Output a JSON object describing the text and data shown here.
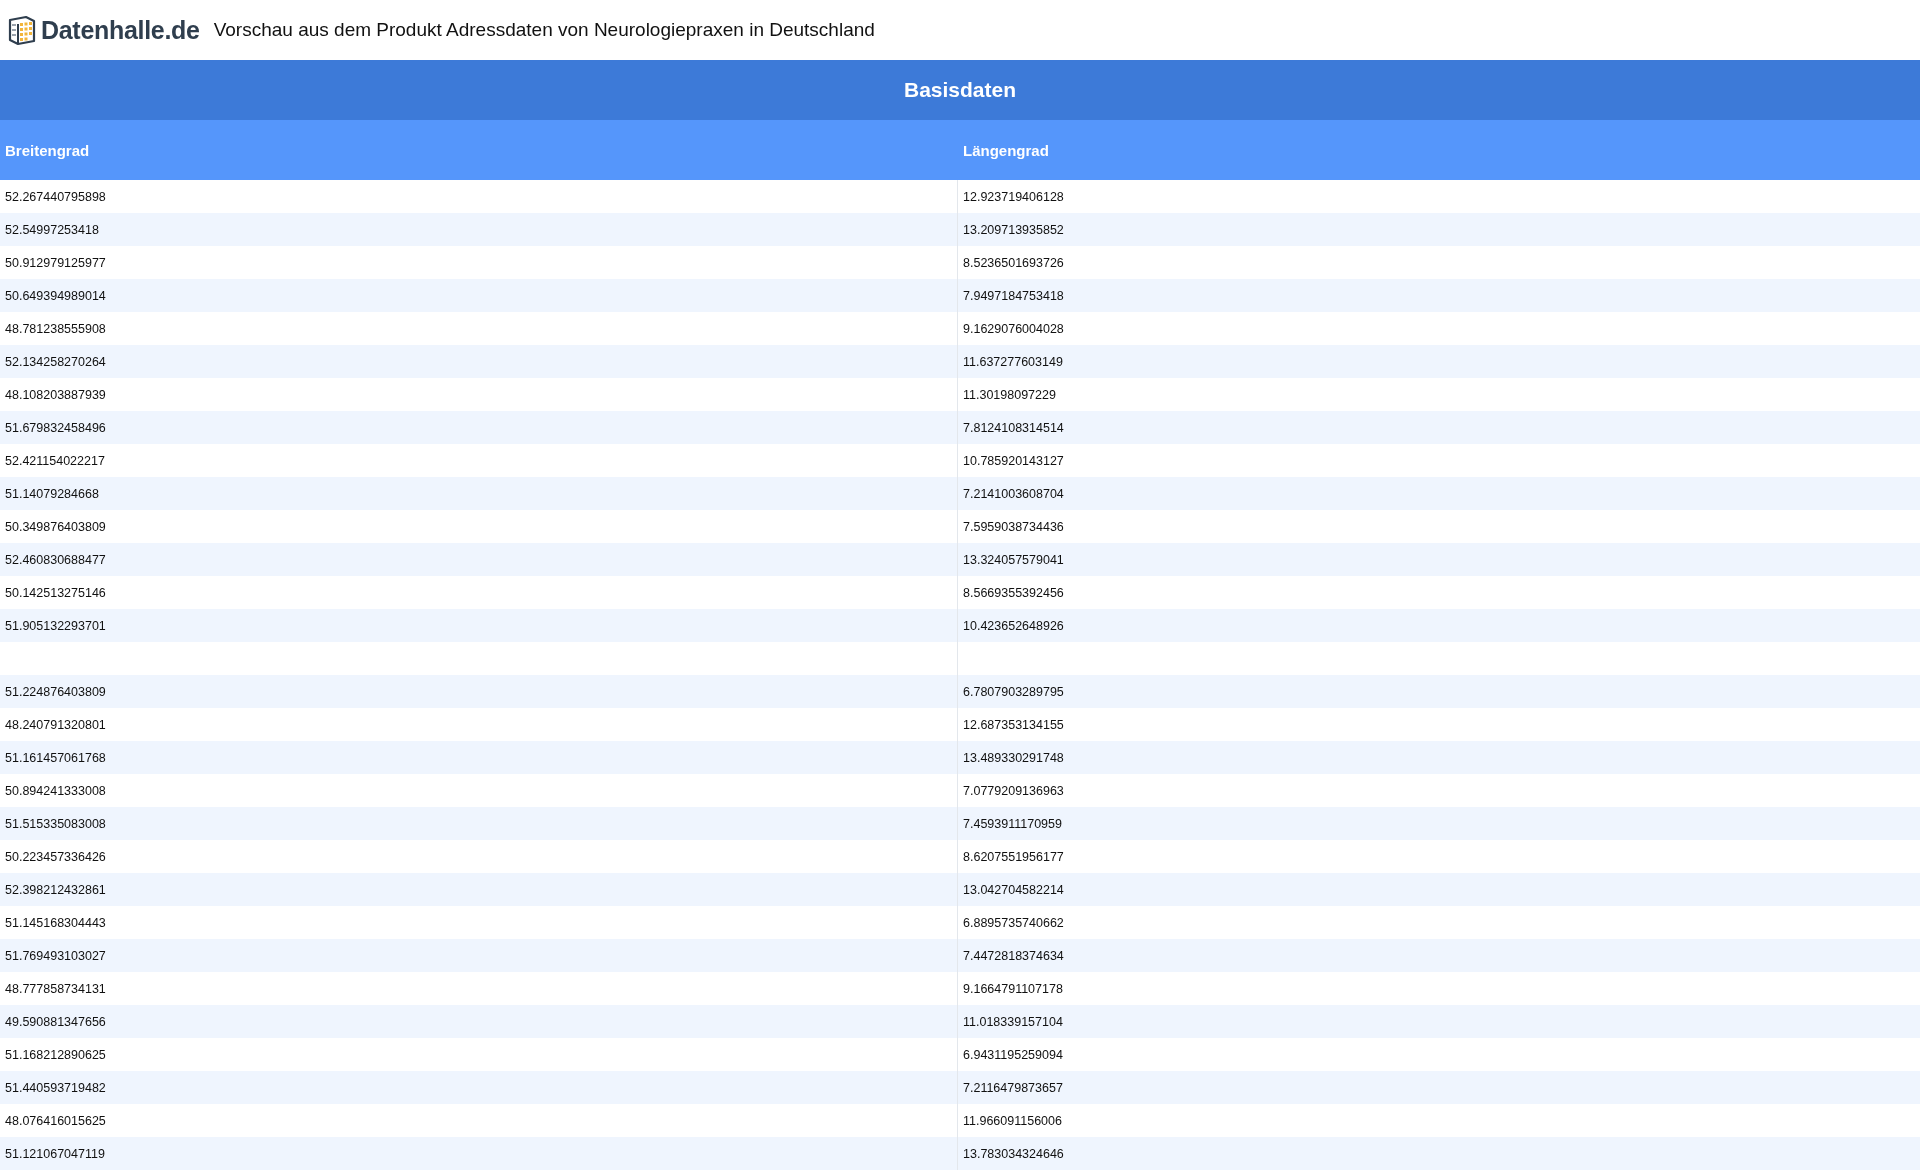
{
  "header": {
    "logo_text": "Datenhalle.de",
    "title": "Vorschau aus dem Produkt Adressdaten von Neurologiepraxen in Deutschland"
  },
  "table": {
    "caption": "Basisdaten",
    "columns": [
      "Breitengrad",
      "Längengrad"
    ],
    "rows": [
      [
        "52.267440795898",
        "12.923719406128"
      ],
      [
        "52.54997253418",
        "13.209713935852"
      ],
      [
        "50.912979125977",
        "8.5236501693726"
      ],
      [
        "50.649394989014",
        "7.9497184753418"
      ],
      [
        "48.781238555908",
        "9.1629076004028"
      ],
      [
        "52.134258270264",
        "11.637277603149"
      ],
      [
        "48.108203887939",
        "11.30198097229"
      ],
      [
        "51.679832458496",
        "7.8124108314514"
      ],
      [
        "52.421154022217",
        "10.785920143127"
      ],
      [
        "51.14079284668",
        "7.2141003608704"
      ],
      [
        "50.349876403809",
        "7.5959038734436"
      ],
      [
        "52.460830688477",
        "13.324057579041"
      ],
      [
        "50.142513275146",
        "8.5669355392456"
      ],
      [
        "51.905132293701",
        "10.423652648926"
      ],
      [],
      [
        "51.224876403809",
        "6.7807903289795"
      ],
      [
        "48.240791320801",
        "12.687353134155"
      ],
      [
        "51.161457061768",
        "13.489330291748"
      ],
      [
        "50.894241333008",
        "7.0779209136963"
      ],
      [
        "51.515335083008",
        "7.4593911170959"
      ],
      [
        "50.223457336426",
        "8.6207551956177"
      ],
      [
        "52.398212432861",
        "13.042704582214"
      ],
      [
        "51.145168304443",
        "6.8895735740662"
      ],
      [
        "51.769493103027",
        "7.4472818374634"
      ],
      [
        "48.777858734131",
        "9.1664791107178"
      ],
      [
        "49.590881347656",
        "11.018339157104"
      ],
      [
        "51.168212890625",
        "6.9431195259094"
      ],
      [
        "51.440593719482",
        "7.2116479873657"
      ],
      [
        "48.076416015625",
        "11.966091156006"
      ],
      [
        "51.121067047119",
        "13.783034324646"
      ]
    ]
  }
}
